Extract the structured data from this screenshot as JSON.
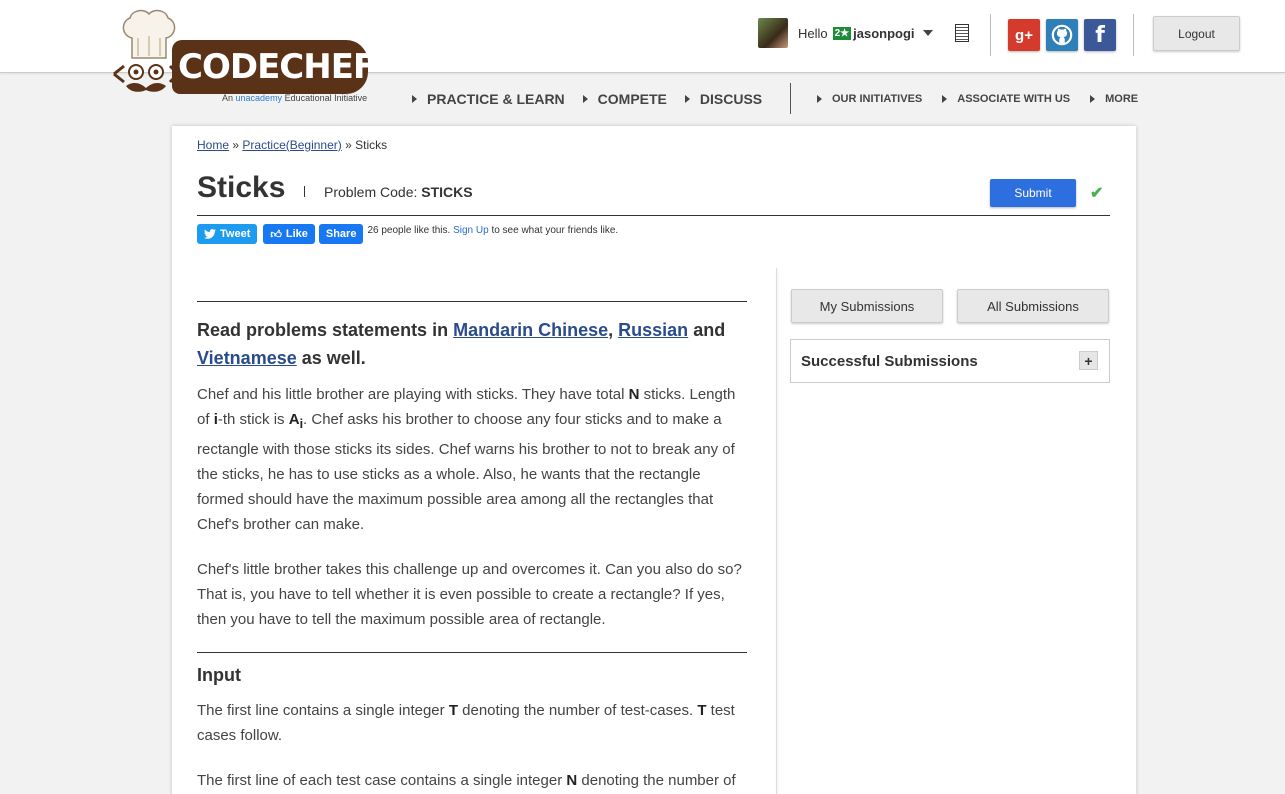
{
  "header": {
    "logo_text": "CODECHEF",
    "tagline_prefix": "An",
    "tagline_brand": "unacademy",
    "tagline_suffix": "Educational Initiative",
    "hello": "Hello",
    "rating_badge": "2★",
    "username": "jasonpogi",
    "social": {
      "gplus": "g+",
      "fb": "f"
    },
    "logout_label": "Logout"
  },
  "nav": {
    "main": [
      "PRACTICE & LEARN",
      "COMPETE",
      "DISCUSS"
    ],
    "sub": [
      "OUR INITIATIVES",
      "ASSOCIATE WITH US",
      "MORE"
    ]
  },
  "breadcrumb": {
    "home": "Home",
    "sep": "»",
    "practice": "Practice(Beginner)",
    "current": "Sticks"
  },
  "problem": {
    "title": "Sticks",
    "code_label": "Problem Code:",
    "code": "STICKS",
    "submit_label": "Submit",
    "check": "✔"
  },
  "share": {
    "tweet": "Tweet",
    "like": "Like",
    "share": "Share",
    "count_text": "26 people like this.",
    "signup": "Sign Up",
    "rest": "to see what your friends like."
  },
  "statement": {
    "langs_prefix": "Read problems statements in",
    "lang1": "Mandarin Chinese",
    "lang2": "Russian",
    "and": "and",
    "lang3": "Vietnamese",
    "langs_suffix": "as well.",
    "p1_a": "Chef and his little brother are playing with sticks. They have total",
    "p1_N": "N",
    "p1_b": "sticks. Length of",
    "p1_i": "i",
    "p1_c": "-th stick is",
    "p1_A": "A",
    "p1_sub": "i",
    "p1_d": ". Chef asks his brother to choose any four sticks and to make a rectangle with those sticks its sides. Chef warns his brother to not to break any of the sticks, he has to use sticks as a whole. Also, he wants that the rectangle formed should have the maximum possible area among all the rectangles that Chef's brother can make.",
    "p2": "Chef's little brother takes this challenge up and overcomes it. Can you also do so? That is, you have to tell whether it is even possible to create a rectangle? If yes, then you have to tell the maximum possible area of rectangle.",
    "input_heading": "Input",
    "in1_a": "The first line contains a single integer",
    "in1_T": "T",
    "in1_b": "denoting the number of test-cases.",
    "in1_T2": "T",
    "in1_c": "test cases follow.",
    "in2_a": "The first line of each test case contains a single integer",
    "in2_N": "N",
    "in2_b": "denoting the number of"
  },
  "side": {
    "my_submissions": "My Submissions",
    "all_submissions": "All Submissions",
    "successful": "Successful Submissions",
    "plus": "+"
  }
}
